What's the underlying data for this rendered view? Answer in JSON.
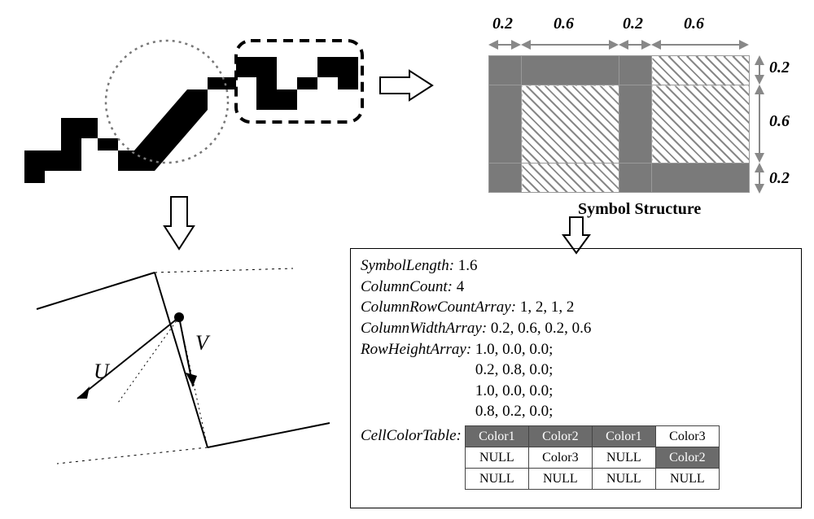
{
  "dimensions": {
    "top": [
      "0.2",
      "0.6",
      "0.2",
      "0.6"
    ],
    "right": [
      "0.2",
      "0.6",
      "0.2"
    ]
  },
  "symbol_caption": "Symbol Structure",
  "uv": {
    "u": "U",
    "v": "V"
  },
  "props": {
    "symbol_length_label": "SymbolLength:",
    "symbol_length_value": "1.6",
    "column_count_label": "ColumnCount:",
    "column_count_value": "4",
    "col_row_count_label": "ColumnRowCountArray:",
    "col_row_count_value": "1, 2, 1, 2",
    "col_width_label": "ColumnWidthArray:",
    "col_width_value": "0.2, 0.6, 0.2, 0.6",
    "row_height_label": "RowHeightArray:",
    "row_height_lines": [
      "1.0, 0.0, 0.0;",
      "0.2, 0.8, 0.0;",
      "1.0, 0.0, 0.0;",
      "0.8, 0.2, 0.0;"
    ],
    "cell_color_label": "CellColorTable:"
  },
  "color_table": [
    [
      {
        "text": "Color1",
        "style": "dark"
      },
      {
        "text": "Color2",
        "style": "dark"
      },
      {
        "text": "Color1",
        "style": "dark"
      },
      {
        "text": "Color3",
        "style": "light"
      }
    ],
    [
      {
        "text": "NULL",
        "style": "light"
      },
      {
        "text": "Color3",
        "style": "light"
      },
      {
        "text": "NULL",
        "style": "light"
      },
      {
        "text": "Color2",
        "style": "dark"
      }
    ],
    [
      {
        "text": "NULL",
        "style": "light"
      },
      {
        "text": "NULL",
        "style": "light"
      },
      {
        "text": "NULL",
        "style": "light"
      },
      {
        "text": "NULL",
        "style": "light"
      }
    ]
  ],
  "chart_data": {
    "type": "table",
    "title": "Symbol Structure",
    "column_widths": [
      0.2,
      0.6,
      0.2,
      0.6
    ],
    "row_heights": [
      0.2,
      0.6,
      0.2
    ],
    "cells": [
      [
        "solid",
        "solid",
        "solid",
        "hatch"
      ],
      [
        "solid",
        "hatch",
        "solid",
        "hatch"
      ],
      [
        "solid",
        "hatch",
        "solid",
        "solid"
      ]
    ],
    "symbol_length": 1.6,
    "column_count": 4,
    "column_row_count_array": [
      1,
      2,
      1,
      2
    ],
    "column_width_array": [
      0.2,
      0.6,
      0.2,
      0.6
    ],
    "row_height_array": [
      [
        1.0,
        0.0,
        0.0
      ],
      [
        0.2,
        0.8,
        0.0
      ],
      [
        1.0,
        0.0,
        0.0
      ],
      [
        0.8,
        0.2,
        0.0
      ]
    ],
    "cell_color_table": [
      [
        "Color1",
        "Color2",
        "Color1",
        "Color3"
      ],
      [
        "NULL",
        "Color3",
        "NULL",
        "Color2"
      ],
      [
        "NULL",
        "NULL",
        "NULL",
        "NULL"
      ]
    ]
  }
}
